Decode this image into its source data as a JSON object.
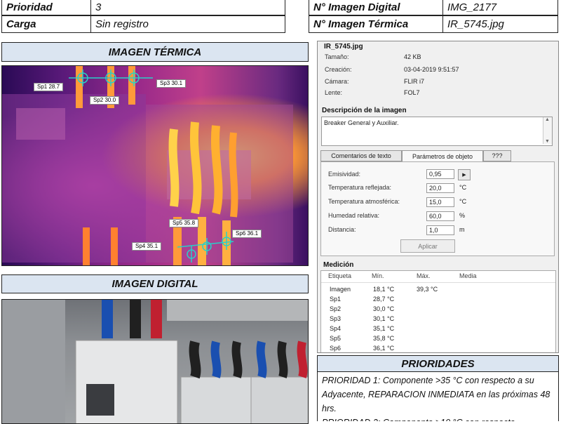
{
  "top_left": [
    {
      "label": "Prioridad",
      "value": "3"
    },
    {
      "label": "Carga",
      "value": "Sin registro"
    }
  ],
  "top_right": [
    {
      "label": "N° Imagen Digital",
      "value": "IMG_2177"
    },
    {
      "label": "N° Imagen Térmica",
      "value": "IR_5745.jpg"
    }
  ],
  "thermal": {
    "title": "IMAGEN TÉRMICA",
    "spots": [
      {
        "name": "Sp1",
        "label": "Sp1 28.7"
      },
      {
        "name": "Sp2",
        "label": "Sp2 30.0"
      },
      {
        "name": "Sp3",
        "label": "Sp3 30.1"
      },
      {
        "name": "Sp4",
        "label": "Sp4 35.1"
      },
      {
        "name": "Sp5",
        "label": "Sp5 35.8"
      },
      {
        "name": "Sp6",
        "label": "Sp6 36.1"
      }
    ]
  },
  "digital": {
    "title": "IMAGEN DIGITAL"
  },
  "info_panel": {
    "filename": "IR_5745.jpg",
    "fields": [
      {
        "label": "Tamaño:",
        "value": "42 KB"
      },
      {
        "label": "Creación:",
        "value": "03-04-2019 9:51:57"
      },
      {
        "label": "Cámara:",
        "value": "FLIR i7"
      },
      {
        "label": "Lente:",
        "value": "FOL7"
      }
    ],
    "description_title": "Descripción de la imagen",
    "description": "Breaker General y Auxiliar.",
    "tabs": [
      "Comentarios de texto",
      "Parámetros de objeto",
      "???"
    ],
    "params": [
      {
        "label": "Emisividad:",
        "value": "0,95",
        "unit": ""
      },
      {
        "label": "Temperatura reflejada:",
        "value": "20,0",
        "unit": "°C"
      },
      {
        "label": "Temperatura atmosférica:",
        "value": "15,0",
        "unit": "°C"
      },
      {
        "label": "Humedad relativa:",
        "value": "60,0",
        "unit": "%"
      },
      {
        "label": "Distancia:",
        "value": "1,0",
        "unit": "m"
      }
    ],
    "apply_label": "Aplicar",
    "measurement_title": "Medición",
    "columns": [
      "Etiqueta",
      "Mín.",
      "Máx.",
      "Media"
    ],
    "rows": [
      {
        "tag": "Imagen",
        "min": "18,1 °C",
        "max": "39,3 °C",
        "avg": ""
      },
      {
        "tag": "Sp1",
        "min": "28,7 °C",
        "max": "",
        "avg": ""
      },
      {
        "tag": "Sp2",
        "min": "30,0 °C",
        "max": "",
        "avg": ""
      },
      {
        "tag": "Sp3",
        "min": "30,1 °C",
        "max": "",
        "avg": ""
      },
      {
        "tag": "Sp4",
        "min": "35,1 °C",
        "max": "",
        "avg": ""
      },
      {
        "tag": "Sp5",
        "min": "35,8 °C",
        "max": "",
        "avg": ""
      },
      {
        "tag": "Sp6",
        "min": "36,1 °C",
        "max": "",
        "avg": ""
      }
    ]
  },
  "priorities": {
    "title": "PRIORIDADES",
    "p1": "PRIORIDAD 1: Componente >35 °C con respecto a su Adyacente, REPARACION INMEDIATA en las próximas 48 hrs.",
    "p2": "PRIORIDAD 2: Componente >10 °C con respecto"
  }
}
